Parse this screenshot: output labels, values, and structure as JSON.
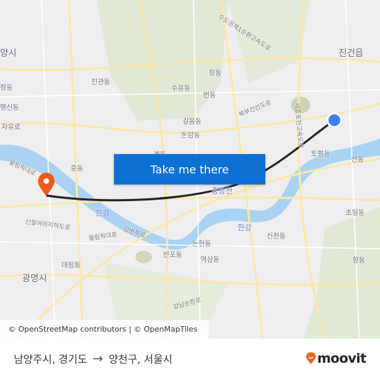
{
  "map": {
    "labels": {
      "jingeon": "진건읍",
      "goyang": "양시",
      "jingwan": "진관동",
      "suyu": "수유동",
      "chang": "창동",
      "beon": "번동",
      "gireum": "길음동",
      "donam": "돈암동",
      "jeong": "정동",
      "haengsin": "행신동",
      "jayuro": "자유로",
      "jung": "중동",
      "olympic1": "올림픽대로",
      "olympic2": "올림픽대로",
      "sinwol": "신월여의지하도로",
      "gangbyeon": "강변북로",
      "hangang1": "한강",
      "hangang2": "한강",
      "jungnang": "중랑천",
      "daerim": "대림동",
      "gwangmyeong": "광명시",
      "banpo": "반포동",
      "nonhyeon": "논현동",
      "yeoksam": "역삼동",
      "sincheon": "신천동",
      "choil": "초일동",
      "hang": "항동",
      "topyeong": "토평동",
      "seon": "선동",
      "gangnamsunhwan": "강남순환로",
      "sudogwon": "수도권제1순환고속도로",
      "sejong": "세종포천고속도로",
      "bukbu": "북부간선도로",
      "gye": "계동"
    },
    "origin_marker_color": "#3b82f6",
    "destination_marker_color": "#f05a1e",
    "route_color": "#222222"
  },
  "cta": {
    "label": "Take me there",
    "color": "#0b72d4"
  },
  "attribution": "© OpenStreetMap contributors | © OpenMapTiles",
  "footer": {
    "origin": "남양주시, 경기도",
    "arrow": "→",
    "destination": "양천구, 서울시",
    "logo_text": "moovit",
    "logo_color": "#f26522"
  }
}
